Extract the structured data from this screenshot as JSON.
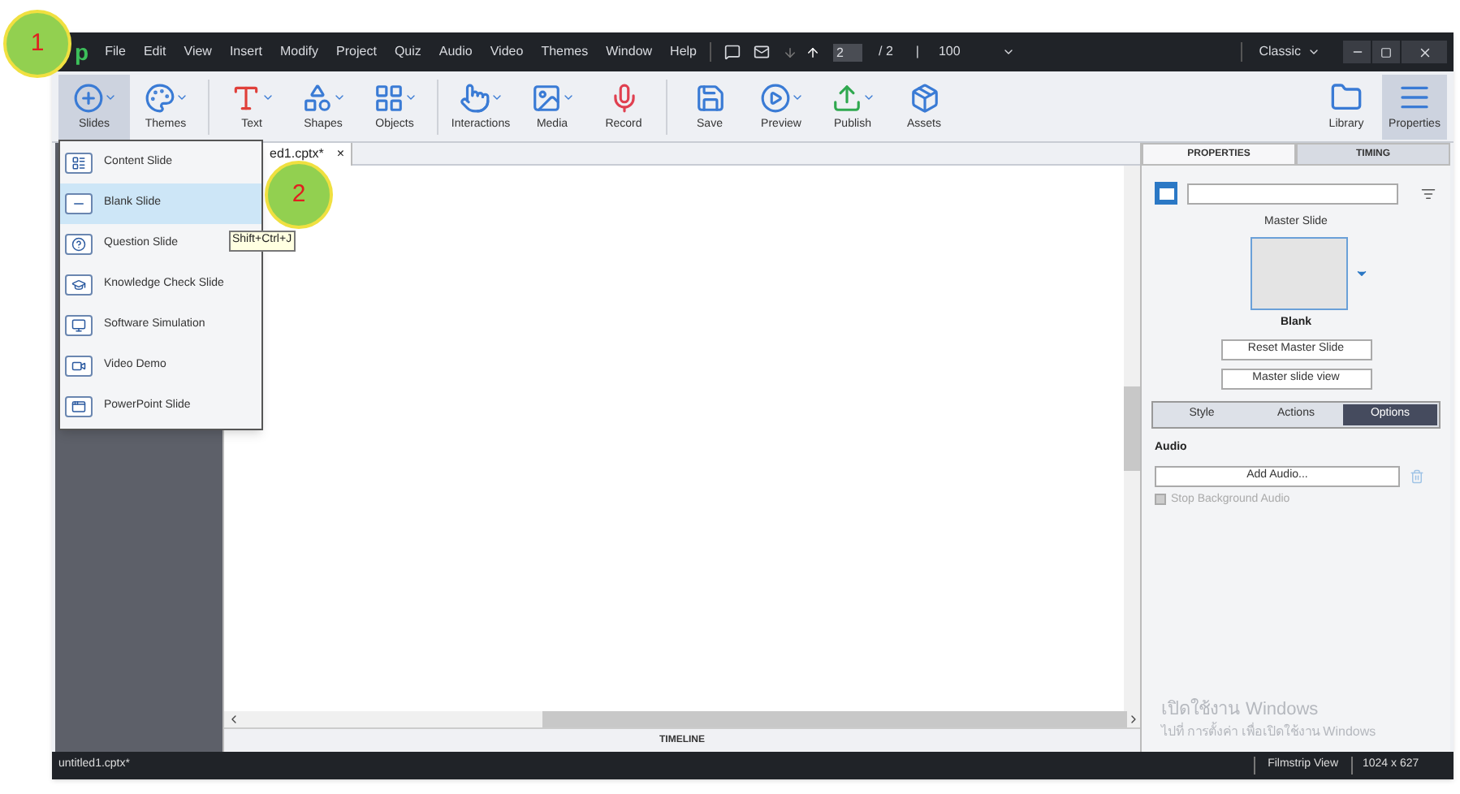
{
  "callouts": [
    "1",
    "2"
  ],
  "title_bar": {
    "logo": "p",
    "menu": [
      "File",
      "Edit",
      "View",
      "Insert",
      "Modify",
      "Project",
      "Quiz",
      "Audio",
      "Video",
      "Themes",
      "Window",
      "Help"
    ],
    "slide_field": "2",
    "slide_total": "/ 2",
    "separator": "|",
    "zoom": "100",
    "workspace": "Classic"
  },
  "toolbar": {
    "groups": [
      [
        {
          "label": "Slides",
          "selected": true,
          "has_menu": true
        },
        {
          "label": "Themes",
          "selected": false,
          "has_menu": true
        }
      ],
      [
        {
          "label": "Text",
          "selected": false,
          "has_menu": true
        },
        {
          "label": "Shapes",
          "selected": false,
          "has_menu": true
        },
        {
          "label": "Objects",
          "selected": false,
          "has_menu": true
        }
      ],
      [
        {
          "label": "Interactions",
          "selected": false,
          "has_menu": true
        },
        {
          "label": "Media",
          "selected": false,
          "has_menu": true
        },
        {
          "label": "Record",
          "selected": false,
          "has_menu": false
        }
      ],
      [
        {
          "label": "Save",
          "selected": false,
          "has_menu": false
        },
        {
          "label": "Preview",
          "selected": false,
          "has_menu": true
        },
        {
          "label": "Publish",
          "selected": false,
          "has_menu": true
        },
        {
          "label": "Assets",
          "selected": false,
          "has_menu": false
        }
      ]
    ],
    "right": [
      {
        "label": "Library",
        "selected": false
      },
      {
        "label": "Properties",
        "selected": true
      }
    ]
  },
  "slides_menu": {
    "items": [
      {
        "label": "Content Slide",
        "selected": false
      },
      {
        "label": "Blank Slide",
        "selected": true
      },
      {
        "label": "Question Slide",
        "selected": false
      },
      {
        "label": "Knowledge Check Slide",
        "selected": false
      },
      {
        "label": "Software Simulation",
        "selected": false
      },
      {
        "label": "Video Demo",
        "selected": false
      },
      {
        "label": "PowerPoint Slide",
        "selected": false
      }
    ],
    "tooltip": "Shift+Ctrl+J"
  },
  "document_tab": {
    "label": "ed1.cptx*",
    "close": "×"
  },
  "timeline": {
    "label": "TIMELINE"
  },
  "properties_panel": {
    "tabs": [
      {
        "label": "PROPERTIES",
        "selected": true
      },
      {
        "label": "TIMING",
        "selected": false
      }
    ],
    "master_slide_label": "Master Slide",
    "master_name": "Blank",
    "buttons": [
      "Reset Master Slide",
      "Master slide view"
    ],
    "subtabs": [
      {
        "label": "Style",
        "selected": false
      },
      {
        "label": "Actions",
        "selected": false
      },
      {
        "label": "Options",
        "selected": true
      }
    ],
    "audio_heading": "Audio",
    "add_audio": "Add Audio...",
    "stop_background_audio": {
      "label": "Stop Background Audio",
      "checked": false,
      "disabled": true
    }
  },
  "activation_notice": {
    "title": "เปิดใช้งาน Windows",
    "subtitle": "ไปที่ การตั้งค่า เพื่อเปิดใช้งาน Windows"
  },
  "status_bar": {
    "file": "untitled1.cptx*",
    "view": "Filmstrip View",
    "size": "1024 x 627"
  }
}
